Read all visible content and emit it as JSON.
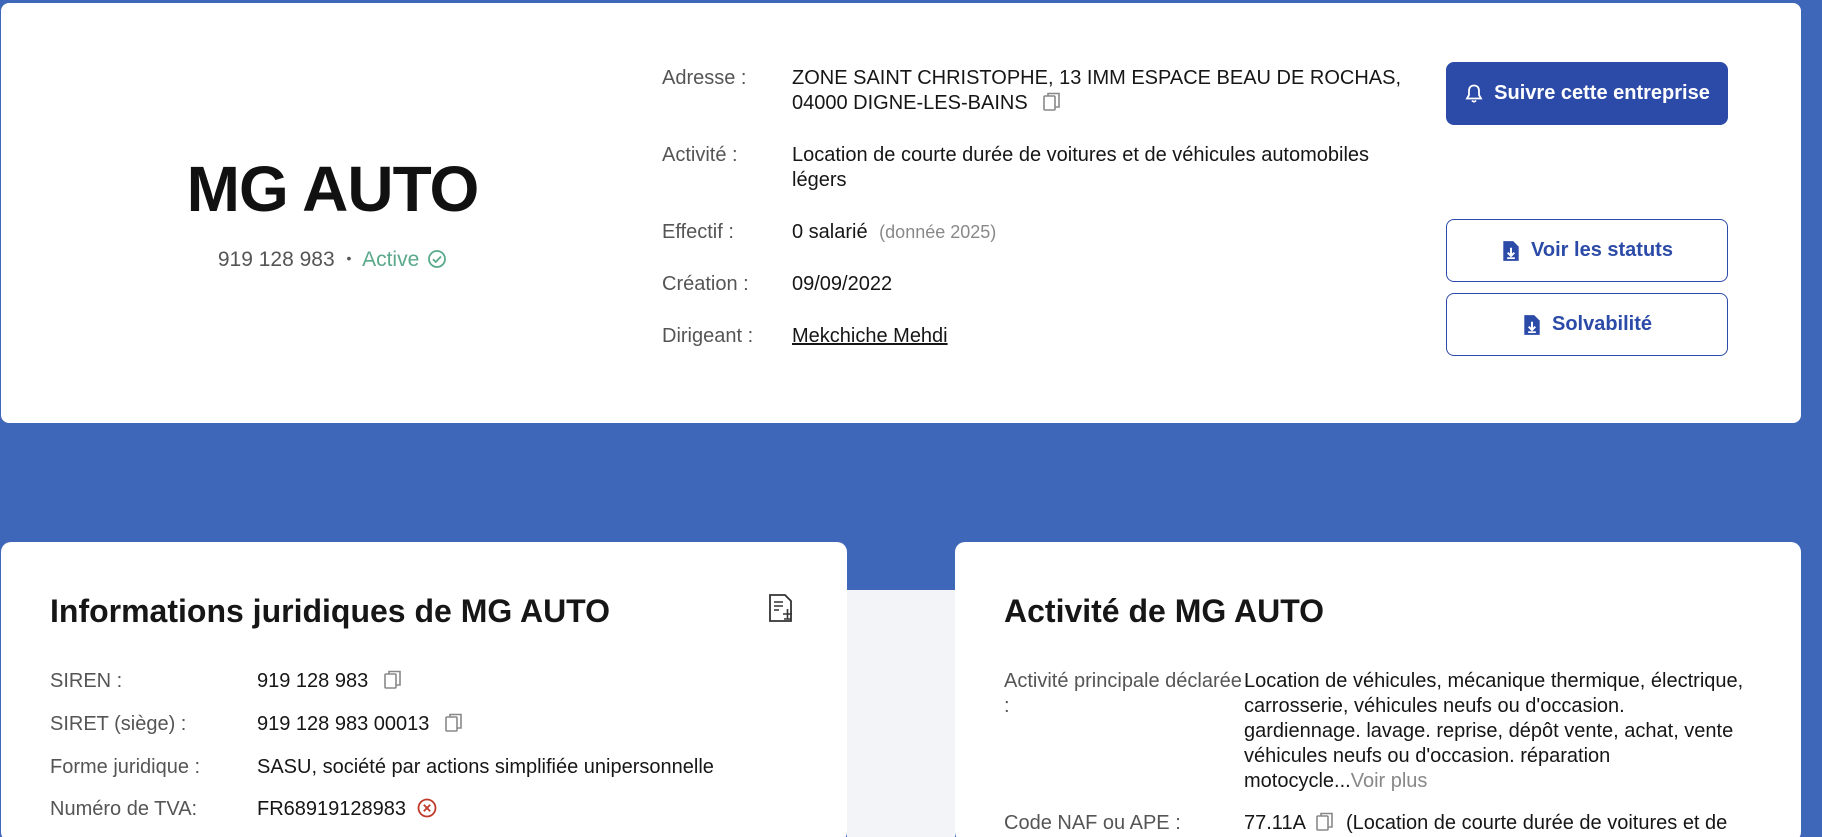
{
  "company": {
    "name": "MG AUTO",
    "siren_display": "919 128 983",
    "separator": "•",
    "status": "Active"
  },
  "details": {
    "address_label": "Adresse :",
    "address_line1": "ZONE SAINT CHRISTOPHE, 13 IMM ESPACE BEAU DE ROCHAS,",
    "address_line2": "04000 DIGNE-LES-BAINS",
    "activity_label": "Activité :",
    "activity_value": "Location de courte durée de voitures et de véhicules automobiles légers",
    "effectif_label": "Effectif :",
    "effectif_value": "0 salarié",
    "effectif_note": "(donnée 2025)",
    "creation_label": "Création :",
    "creation_value": "09/09/2022",
    "dirigeant_label": "Dirigeant :",
    "dirigeant_value": "Mekchiche Mehdi"
  },
  "actions": {
    "follow_label": "Suivre cette entreprise",
    "statuts_label": "Voir les statuts",
    "solvabilite_label": "Solvabilité"
  },
  "juridique": {
    "title": "Informations juridiques de MG AUTO",
    "siren_label": "SIREN :",
    "siren_value": "919 128 983",
    "siret_label": "SIRET (siège) :",
    "siret_value": "919 128 983 00013",
    "forme_label": "Forme juridique :",
    "forme_value": "SASU, société par actions simplifiée unipersonnelle",
    "tva_label": "Numéro de TVA:",
    "tva_value": "FR68919128983"
  },
  "activite": {
    "title": "Activité de MG AUTO",
    "principale_label": "Activité principale déclarée :",
    "principale_value": "Location de véhicules, mécanique thermique, électrique, carrosserie, véhicules neufs ou d'occasion. gardiennage. lavage. reprise, dépôt vente, achat, vente véhicules neufs ou d'occasion. réparation motocycle...",
    "voir_plus": "Voir plus",
    "naf_label": "Code NAF ou APE :",
    "naf_value": "77.11A",
    "naf_desc": "(Location de courte durée de voitures et de"
  },
  "colors": {
    "background": "#3f67b9",
    "primary": "#2c4ba8",
    "active": "#5aa98b",
    "error": "#c0392b"
  },
  "icons": [
    "copy-icon",
    "bell-icon",
    "file-download-icon",
    "check-circle-icon",
    "document-scale-icon",
    "x-circle-icon"
  ]
}
